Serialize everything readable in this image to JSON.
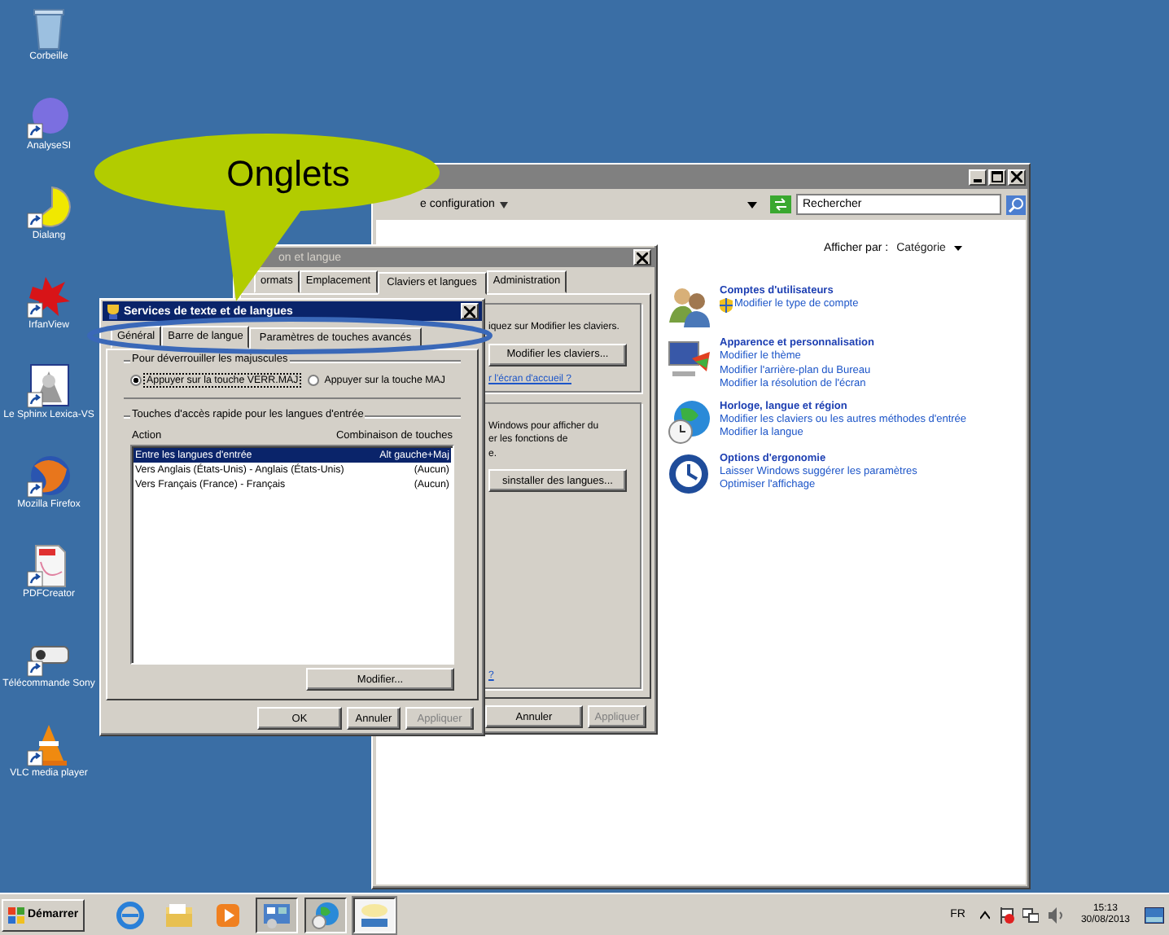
{
  "desktop_icons": [
    {
      "label": "Corbeille",
      "kind": "trash",
      "shortcut": false
    },
    {
      "label": "AnalyseSI",
      "kind": "disc",
      "shortcut": true
    },
    {
      "label": "Dialang",
      "kind": "moon",
      "shortcut": true
    },
    {
      "label": "IrfanView",
      "kind": "splash",
      "shortcut": true
    },
    {
      "label": "Le Sphinx Lexica-VS",
      "kind": "figure",
      "shortcut": true
    },
    {
      "label": "Mozilla Firefox",
      "kind": "globe",
      "shortcut": true
    },
    {
      "label": "PDFCreator",
      "kind": "document",
      "shortcut": true
    },
    {
      "label": "Télécommande Sony",
      "kind": "projector",
      "shortcut": true
    },
    {
      "label": "VLC media player",
      "kind": "cone",
      "shortcut": true
    }
  ],
  "control_panel": {
    "address": "e configuration",
    "search": {
      "placeholder": "Rechercher"
    },
    "view_label": "Afficher par :",
    "view_value": "Catégorie",
    "categories": [
      {
        "kind": "users",
        "title": "Comptes d'utilisateurs",
        "links": [
          {
            "text": "Modifier le type de compte",
            "shield": true
          }
        ]
      },
      {
        "kind": "display",
        "title": "Apparence et personnalisation",
        "links": [
          {
            "text": "Modifier le thème",
            "shield": false
          },
          {
            "text": "Modifier l'arrière-plan du Bureau",
            "shield": false
          },
          {
            "text": "Modifier la résolution de l'écran",
            "shield": false
          }
        ]
      },
      {
        "kind": "clock",
        "title": "Horloge, langue et région",
        "links": [
          {
            "text": "Modifier les claviers ou les autres méthodes d'entrée",
            "shield": false
          },
          {
            "text": "Modifier la langue",
            "shield": false
          }
        ]
      },
      {
        "kind": "access",
        "title": "Options d'ergonomie",
        "links": [
          {
            "text": "Laisser Windows suggérer les paramètres",
            "shield": false
          },
          {
            "text": "Optimiser l'affichage",
            "shield": false
          }
        ]
      }
    ]
  },
  "region_dialog": {
    "title": "on et langue",
    "tabs": [
      {
        "label": "ormats",
        "selected": false
      },
      {
        "label": "Emplacement",
        "selected": false
      },
      {
        "label": "Claviers et langues",
        "selected": true
      },
      {
        "label": "Administration",
        "selected": false
      }
    ],
    "keyboard_text": "iquez sur Modifier les claviers.",
    "keyboard_button": "Modifier les claviers...",
    "welcome_link": "r l'écran d'accueil ?",
    "language_text": [
      "Windows pour afficher du",
      "er les fonctions de",
      "e."
    ],
    "install_button": "sinstaller des langues...",
    "help_link": "?",
    "buttons": [
      {
        "label": "Annuler",
        "disabled": false
      },
      {
        "label": "Appliquer",
        "disabled": true
      }
    ]
  },
  "services_dialog": {
    "title": "Services de texte et de langues",
    "tabs": [
      {
        "label": "Général",
        "selected": false
      },
      {
        "label": "Barre de langue",
        "selected": false
      },
      {
        "label": "Paramètres de touches avancés",
        "selected": true
      }
    ],
    "caps_group": "Pour déverrouiller les majuscules",
    "caps_options": [
      {
        "label": "Appuyer sur la touche VERR.MAJ",
        "selected": true
      },
      {
        "label": "Appuyer sur la touche MAJ",
        "selected": false
      }
    ],
    "hotkey_group": "Touches d'accès rapide pour les langues d'entrée",
    "columns": [
      "Action",
      "Combinaison de touches"
    ],
    "rows": [
      {
        "action": "Entre les langues d'entrée",
        "keys": "Alt gauche+Maj",
        "selected": true
      },
      {
        "action": "Vers Anglais (États-Unis) - Anglais (États-Unis)",
        "keys": "(Aucun)",
        "selected": false
      },
      {
        "action": "Vers Français (France) - Français",
        "keys": "(Aucun)",
        "selected": false
      }
    ],
    "change_button": "Modifier...",
    "buttons": [
      {
        "label": "OK",
        "disabled": false
      },
      {
        "label": "Annuler",
        "disabled": false
      },
      {
        "label": "Appliquer",
        "disabled": true
      }
    ]
  },
  "callout": {
    "text": "Onglets"
  },
  "taskbar": {
    "start": "Démarrer",
    "apps": [
      {
        "kind": "browser",
        "open": false,
        "selected": false
      },
      {
        "kind": "folder",
        "open": false,
        "selected": false
      },
      {
        "kind": "player",
        "open": false,
        "selected": false
      },
      {
        "kind": "panel",
        "open": true,
        "selected": false
      },
      {
        "kind": "globe",
        "open": true,
        "selected": false
      },
      {
        "kind": "keyboard",
        "open": true,
        "selected": true
      }
    ],
    "language": "FR",
    "time": "15:13",
    "date": "30/08/2013"
  }
}
